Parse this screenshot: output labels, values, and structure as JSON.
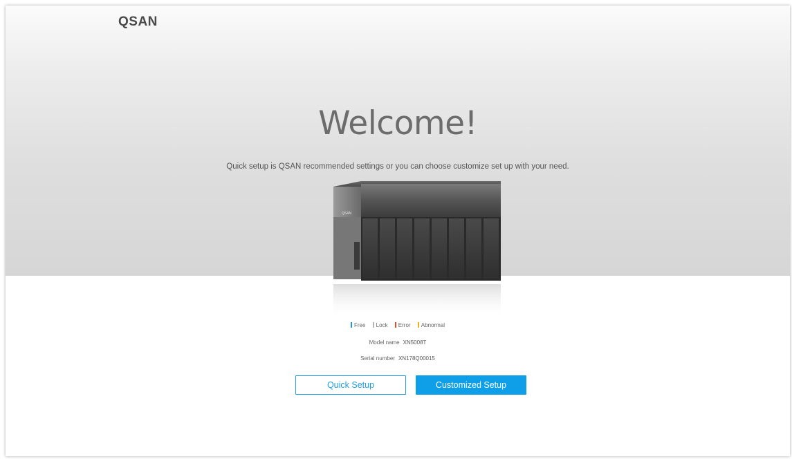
{
  "brand": {
    "logo_text": "QSAN"
  },
  "hero": {
    "title": "Welcome!",
    "subtitle": "Quick setup is QSAN recommended settings or you can choose customize set up with your need."
  },
  "device": {
    "badge": "QSAN",
    "bays": 8
  },
  "legend": [
    {
      "label": "Free",
      "color": "#1e90e6"
    },
    {
      "label": "Lock",
      "color": "#b5b5b5"
    },
    {
      "label": "Error",
      "color": "#e84a2a"
    },
    {
      "label": "Abnormal",
      "color": "#f0b020"
    }
  ],
  "info": {
    "model_label": "Model name",
    "model_value": "XN5008T",
    "serial_label": "Serial number",
    "serial_value": "XN178Q00015"
  },
  "actions": {
    "quick_label": "Quick Setup",
    "custom_label": "Customized Setup"
  },
  "colors": {
    "accent": "#0e9fe8"
  }
}
